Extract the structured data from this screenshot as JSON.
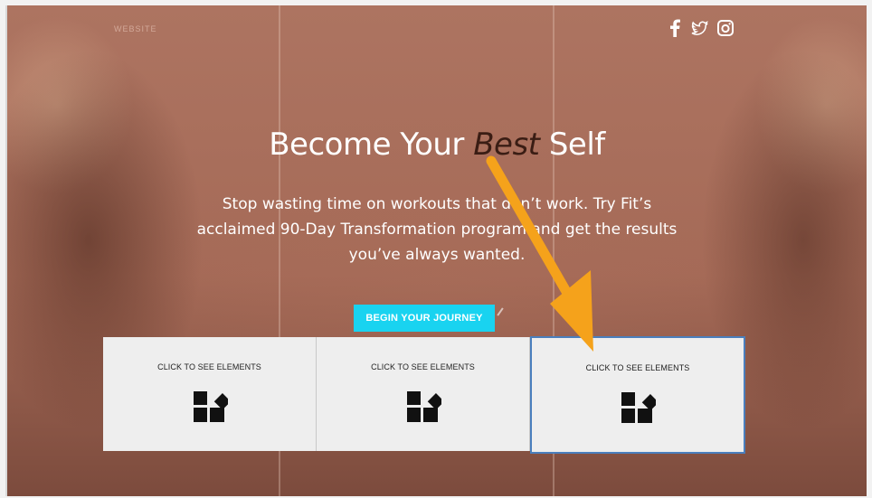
{
  "header": {
    "logo_text": "WEBSITE",
    "social_icons": [
      "facebook-icon",
      "twitter-icon",
      "instagram-icon"
    ]
  },
  "hero": {
    "headline_pre": "Become Your ",
    "headline_em": "Best",
    "headline_post": " Self",
    "subtitle_lines": [
      "Stop wasting time on workouts that don’t work. Try Fit’s",
      "acclaimed 90-Day Transformation program and get the results",
      "you’ve always wanted."
    ],
    "cta_label": "BEGIN YOUR JOURNEY"
  },
  "cards": [
    {
      "label": "CLICK TO SEE ELEMENTS",
      "icon": "elements-icon"
    },
    {
      "label": "CLICK TO SEE ELEMENTS",
      "icon": "elements-icon"
    },
    {
      "label": "CLICK TO SEE ELEMENTS",
      "icon": "elements-icon"
    }
  ],
  "colors": {
    "cta": "#19d3f0",
    "arrow": "#f5a21b",
    "selection": "#4a7fbd"
  }
}
